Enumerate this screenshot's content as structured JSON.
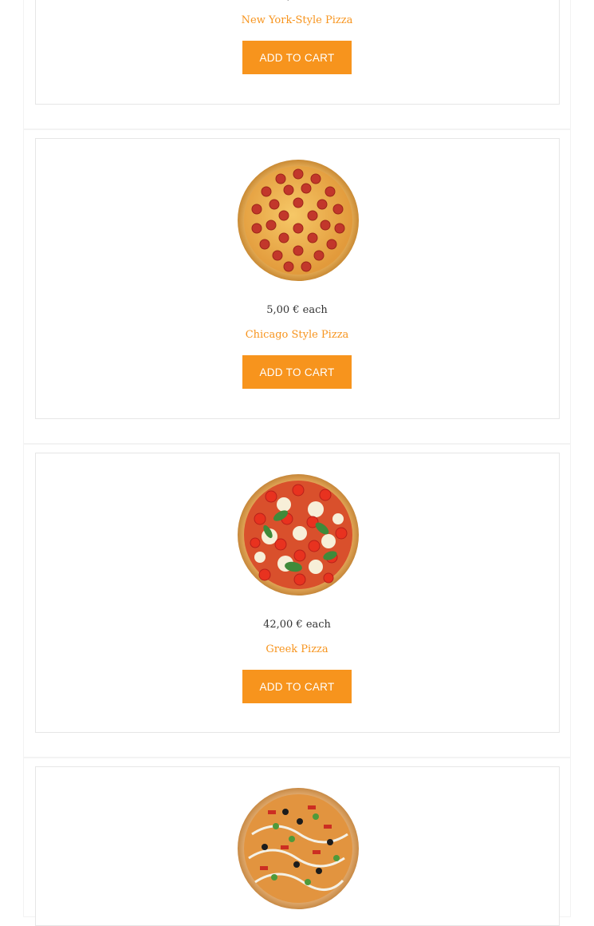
{
  "products": [
    {
      "name": "New York-Style Pizza",
      "price": "",
      "button": "ADD TO CART",
      "image": "new-york-pizza-image"
    },
    {
      "name": "Chicago Style Pizza",
      "price": "5,00 € each",
      "button": "ADD TO CART",
      "image": "pepperoni-pizza-image"
    },
    {
      "name": "Greek Pizza",
      "price": "42,00 € each",
      "button": "ADD TO CART",
      "image": "margherita-pizza-image"
    },
    {
      "name": "",
      "price": "",
      "button": "",
      "image": "veggie-pizza-image"
    }
  ],
  "colors": {
    "accent": "#f7941d",
    "price_text": "#333333",
    "card_border": "#e6e6e6"
  }
}
